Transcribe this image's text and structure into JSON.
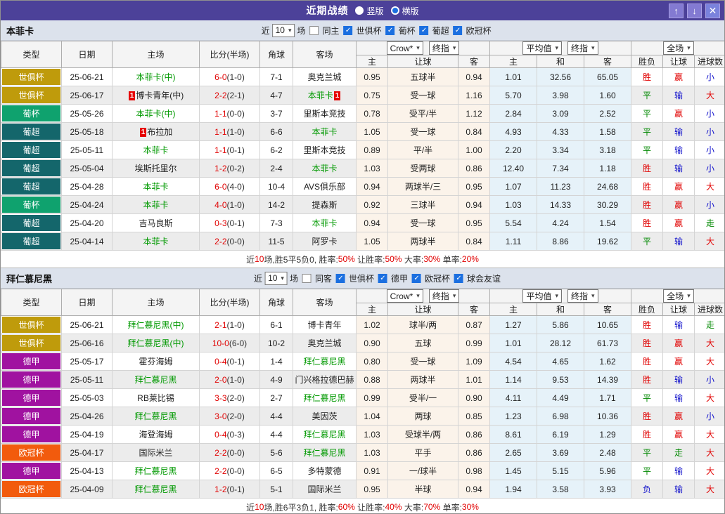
{
  "titlebar": {
    "title": "近期战绩",
    "radios": [
      {
        "label": "竖版",
        "selected": false
      },
      {
        "label": "横版",
        "selected": true
      }
    ]
  },
  "icons": {
    "up": "↑",
    "down": "↓",
    "close": "✕",
    "check": "✓",
    "dropdown": "▾"
  },
  "header_labels": {
    "col_type": "类型",
    "col_date": "日期",
    "col_home": "主场",
    "col_score": "比分(半场)",
    "col_corner": "角球",
    "col_away": "客场",
    "sub_home": "主",
    "sub_handicap": "让球",
    "sub_away": "客",
    "sub_avg_home": "主",
    "sub_draw": "和",
    "sub_avg_away": "客",
    "col_result": "胜负",
    "col_handicap_result": "让球",
    "col_goals": "进球数",
    "select_crow": "Crow*",
    "select_final1": "终指",
    "select_avg": "平均值",
    "select_final2": "终指",
    "select_full": "全场"
  },
  "colors": {
    "titlebar_bg": "#4c4199",
    "checkbox_blue": "#1b6fe0",
    "team_highlight_green": "#009900",
    "score_red": "#e10000",
    "win_red": "#e10000",
    "draw_green": "#008800",
    "lose_blue": "#1414cc",
    "odds_col_bg": "#fbf3ea",
    "avg_col_bg": "#e6f2f9",
    "league_colors": {
      "世俱杯": "#bf9b0b",
      "葡杯": "#0fa26e",
      "葡超": "#14666b",
      "德甲": "#a012a0",
      "欧冠杯": "#f25b0d"
    }
  },
  "sections": [
    {
      "team": "本菲卡",
      "filter": {
        "prefix": "近",
        "count": "10",
        "suffix": "场",
        "same": {
          "label": "同主",
          "checked": false
        },
        "leagues": [
          {
            "label": "世俱杯",
            "checked": true
          },
          {
            "label": "葡杯",
            "checked": true
          },
          {
            "label": "葡超",
            "checked": true
          },
          {
            "label": "欧冠杯",
            "checked": true
          }
        ]
      },
      "rows": [
        {
          "league": "世俱杯",
          "date": "25-06-21",
          "home": "本菲卡(中)",
          "home_focus": true,
          "home_rc": false,
          "ft": "6-0",
          "ht": "(1-0)",
          "corner": "7-1",
          "away": "奥克兰城",
          "away_focus": false,
          "away_rc": false,
          "o1": "0.95",
          "o2": "五球半",
          "o3": "0.94",
          "a1": "1.01",
          "a2": "32.56",
          "a3": "65.05",
          "r1": "胜",
          "r2": "赢",
          "r3": "小"
        },
        {
          "league": "世俱杯",
          "date": "25-06-17",
          "home": "博卡青年(中)",
          "home_focus": false,
          "home_rc": true,
          "ft": "2-2",
          "ht": "(2-1)",
          "corner": "4-7",
          "away": "本菲卡",
          "away_focus": true,
          "away_rc": true,
          "o1": "0.75",
          "o2": "受一球",
          "o3": "1.16",
          "a1": "5.70",
          "a2": "3.98",
          "a3": "1.60",
          "r1": "平",
          "r2": "输",
          "r3": "大"
        },
        {
          "league": "葡杯",
          "date": "25-05-26",
          "home": "本菲卡(中)",
          "home_focus": true,
          "home_rc": false,
          "ft": "1-1",
          "ht": "(0-0)",
          "corner": "3-7",
          "away": "里斯本竞技",
          "away_focus": false,
          "away_rc": false,
          "o1": "0.78",
          "o2": "受平/半",
          "o3": "1.12",
          "a1": "2.84",
          "a2": "3.09",
          "a3": "2.52",
          "r1": "平",
          "r2": "赢",
          "r3": "小"
        },
        {
          "league": "葡超",
          "date": "25-05-18",
          "home": "布拉加",
          "home_focus": false,
          "home_rc": true,
          "ft": "1-1",
          "ht": "(1-0)",
          "corner": "6-6",
          "away": "本菲卡",
          "away_focus": true,
          "away_rc": false,
          "o1": "1.05",
          "o2": "受一球",
          "o3": "0.84",
          "a1": "4.93",
          "a2": "4.33",
          "a3": "1.58",
          "r1": "平",
          "r2": "输",
          "r3": "小"
        },
        {
          "league": "葡超",
          "date": "25-05-11",
          "home": "本菲卡",
          "home_focus": true,
          "home_rc": false,
          "ft": "1-1",
          "ht": "(0-1)",
          "corner": "6-2",
          "away": "里斯本竞技",
          "away_focus": false,
          "away_rc": false,
          "o1": "0.89",
          "o2": "平/半",
          "o3": "1.00",
          "a1": "2.20",
          "a2": "3.34",
          "a3": "3.18",
          "r1": "平",
          "r2": "输",
          "r3": "小"
        },
        {
          "league": "葡超",
          "date": "25-05-04",
          "home": "埃斯托里尔",
          "home_focus": false,
          "home_rc": false,
          "ft": "1-2",
          "ht": "(0-2)",
          "corner": "2-4",
          "away": "本菲卡",
          "away_focus": true,
          "away_rc": false,
          "o1": "1.03",
          "o2": "受两球",
          "o3": "0.86",
          "a1": "12.40",
          "a2": "7.34",
          "a3": "1.18",
          "r1": "胜",
          "r2": "输",
          "r3": "小"
        },
        {
          "league": "葡超",
          "date": "25-04-28",
          "home": "本菲卡",
          "home_focus": true,
          "home_rc": false,
          "ft": "6-0",
          "ht": "(4-0)",
          "corner": "10-4",
          "away": "AVS俱乐部",
          "away_focus": false,
          "away_rc": false,
          "o1": "0.94",
          "o2": "两球半/三",
          "o3": "0.95",
          "a1": "1.07",
          "a2": "11.23",
          "a3": "24.68",
          "r1": "胜",
          "r2": "赢",
          "r3": "大"
        },
        {
          "league": "葡杯",
          "date": "25-04-24",
          "home": "本菲卡",
          "home_focus": true,
          "home_rc": false,
          "ft": "4-0",
          "ht": "(1-0)",
          "corner": "14-2",
          "away": "提森斯",
          "away_focus": false,
          "away_rc": false,
          "o1": "0.92",
          "o2": "三球半",
          "o3": "0.94",
          "a1": "1.03",
          "a2": "14.33",
          "a3": "30.29",
          "r1": "胜",
          "r2": "赢",
          "r3": "小"
        },
        {
          "league": "葡超",
          "date": "25-04-20",
          "home": "吉马良斯",
          "home_focus": false,
          "home_rc": false,
          "ft": "0-3",
          "ht": "(0-1)",
          "corner": "7-3",
          "away": "本菲卡",
          "away_focus": true,
          "away_rc": false,
          "o1": "0.94",
          "o2": "受一球",
          "o3": "0.95",
          "a1": "5.54",
          "a2": "4.24",
          "a3": "1.54",
          "r1": "胜",
          "r2": "赢",
          "r3": "走"
        },
        {
          "league": "葡超",
          "date": "25-04-14",
          "home": "本菲卡",
          "home_focus": true,
          "home_rc": false,
          "ft": "2-2",
          "ht": "(0-0)",
          "corner": "11-5",
          "away": "阿罗卡",
          "away_focus": false,
          "away_rc": false,
          "o1": "1.05",
          "o2": "两球半",
          "o3": "0.84",
          "a1": "1.11",
          "a2": "8.86",
          "a3": "19.62",
          "r1": "平",
          "r2": "输",
          "r3": "大"
        }
      ],
      "summary": [
        "近",
        "10",
        "场,胜5平5负0, 胜率:",
        "50%",
        " 让胜率:",
        "50%",
        " 大率:",
        "30%",
        " 单率:",
        "20%"
      ]
    },
    {
      "team": "拜仁慕尼黑",
      "filter": {
        "prefix": "近",
        "count": "10",
        "suffix": "场",
        "same": {
          "label": "同客",
          "checked": false
        },
        "leagues": [
          {
            "label": "世俱杯",
            "checked": true
          },
          {
            "label": "德甲",
            "checked": true
          },
          {
            "label": "欧冠杯",
            "checked": true
          },
          {
            "label": "球会友谊",
            "checked": true
          }
        ]
      },
      "rows": [
        {
          "league": "世俱杯",
          "date": "25-06-21",
          "home": "拜仁慕尼黑(中)",
          "home_focus": true,
          "home_rc": false,
          "ft": "2-1",
          "ht": "(1-0)",
          "corner": "6-1",
          "away": "博卡青年",
          "away_focus": false,
          "away_rc": false,
          "o1": "1.02",
          "o2": "球半/两",
          "o3": "0.87",
          "a1": "1.27",
          "a2": "5.86",
          "a3": "10.65",
          "r1": "胜",
          "r2": "输",
          "r3": "走"
        },
        {
          "league": "世俱杯",
          "date": "25-06-16",
          "home": "拜仁慕尼黑(中)",
          "home_focus": true,
          "home_rc": false,
          "ft": "10-0",
          "ht": "(6-0)",
          "corner": "10-2",
          "away": "奥克兰城",
          "away_focus": false,
          "away_rc": false,
          "o1": "0.90",
          "o2": "五球",
          "o3": "0.99",
          "a1": "1.01",
          "a2": "28.12",
          "a3": "61.73",
          "r1": "胜",
          "r2": "赢",
          "r3": "大"
        },
        {
          "league": "德甲",
          "date": "25-05-17",
          "home": "霍芬海姆",
          "home_focus": false,
          "home_rc": false,
          "ft": "0-4",
          "ht": "(0-1)",
          "corner": "1-4",
          "away": "拜仁慕尼黑",
          "away_focus": true,
          "away_rc": false,
          "o1": "0.80",
          "o2": "受一球",
          "o3": "1.09",
          "a1": "4.54",
          "a2": "4.65",
          "a3": "1.62",
          "r1": "胜",
          "r2": "赢",
          "r3": "大"
        },
        {
          "league": "德甲",
          "date": "25-05-11",
          "home": "拜仁慕尼黑",
          "home_focus": true,
          "home_rc": false,
          "ft": "2-0",
          "ht": "(1-0)",
          "corner": "4-9",
          "away": "门兴格拉德巴赫",
          "away_focus": false,
          "away_rc": false,
          "o1": "0.88",
          "o2": "两球半",
          "o3": "1.01",
          "a1": "1.14",
          "a2": "9.53",
          "a3": "14.39",
          "r1": "胜",
          "r2": "输",
          "r3": "小"
        },
        {
          "league": "德甲",
          "date": "25-05-03",
          "home": "RB莱比锡",
          "home_focus": false,
          "home_rc": false,
          "ft": "3-3",
          "ht": "(2-0)",
          "corner": "2-7",
          "away": "拜仁慕尼黑",
          "away_focus": true,
          "away_rc": false,
          "o1": "0.99",
          "o2": "受半/一",
          "o3": "0.90",
          "a1": "4.11",
          "a2": "4.49",
          "a3": "1.71",
          "r1": "平",
          "r2": "输",
          "r3": "大"
        },
        {
          "league": "德甲",
          "date": "25-04-26",
          "home": "拜仁慕尼黑",
          "home_focus": true,
          "home_rc": false,
          "ft": "3-0",
          "ht": "(2-0)",
          "corner": "4-4",
          "away": "美因茨",
          "away_focus": false,
          "away_rc": false,
          "o1": "1.04",
          "o2": "两球",
          "o3": "0.85",
          "a1": "1.23",
          "a2": "6.98",
          "a3": "10.36",
          "r1": "胜",
          "r2": "赢",
          "r3": "小"
        },
        {
          "league": "德甲",
          "date": "25-04-19",
          "home": "海登海姆",
          "home_focus": false,
          "home_rc": false,
          "ft": "0-4",
          "ht": "(0-3)",
          "corner": "4-4",
          "away": "拜仁慕尼黑",
          "away_focus": true,
          "away_rc": false,
          "o1": "1.03",
          "o2": "受球半/两",
          "o3": "0.86",
          "a1": "8.61",
          "a2": "6.19",
          "a3": "1.29",
          "r1": "胜",
          "r2": "赢",
          "r3": "大"
        },
        {
          "league": "欧冠杯",
          "date": "25-04-17",
          "home": "国际米兰",
          "home_focus": false,
          "home_rc": false,
          "ft": "2-2",
          "ht": "(0-0)",
          "corner": "5-6",
          "away": "拜仁慕尼黑",
          "away_focus": true,
          "away_rc": false,
          "o1": "1.03",
          "o2": "平手",
          "o3": "0.86",
          "a1": "2.65",
          "a2": "3.69",
          "a3": "2.48",
          "r1": "平",
          "r2": "走",
          "r3": "大"
        },
        {
          "league": "德甲",
          "date": "25-04-13",
          "home": "拜仁慕尼黑",
          "home_focus": true,
          "home_rc": false,
          "ft": "2-2",
          "ht": "(0-0)",
          "corner": "6-5",
          "away": "多特蒙德",
          "away_focus": false,
          "away_rc": false,
          "o1": "0.91",
          "o2": "一/球半",
          "o3": "0.98",
          "a1": "1.45",
          "a2": "5.15",
          "a3": "5.96",
          "r1": "平",
          "r2": "输",
          "r3": "大"
        },
        {
          "league": "欧冠杯",
          "date": "25-04-09",
          "home": "拜仁慕尼黑",
          "home_focus": true,
          "home_rc": false,
          "ft": "1-2",
          "ht": "(0-1)",
          "corner": "5-1",
          "away": "国际米兰",
          "away_focus": false,
          "away_rc": false,
          "o1": "0.95",
          "o2": "半球",
          "o3": "0.94",
          "a1": "1.94",
          "a2": "3.58",
          "a3": "3.93",
          "r1": "负",
          "r2": "输",
          "r3": "大"
        }
      ],
      "summary": [
        "近",
        "10",
        "场,胜6平3负1, 胜率:",
        "60%",
        " 让胜率:",
        "40%",
        " 大率:",
        "70%",
        " 单率:",
        "30%"
      ]
    }
  ]
}
